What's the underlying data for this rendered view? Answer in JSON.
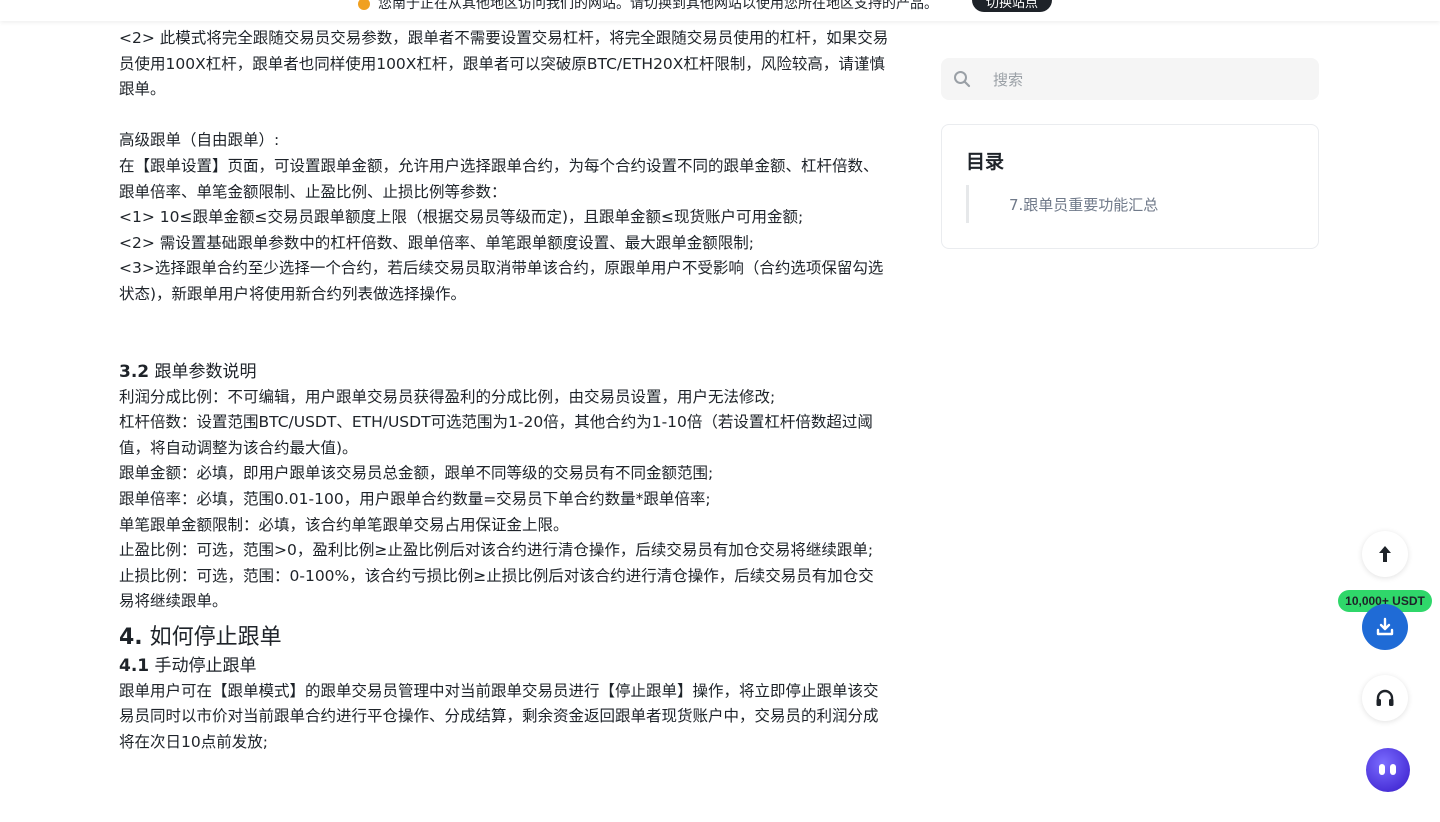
{
  "topbar": {
    "notice": "您南于正在从其他地区访问我们的网站。请切换到其他网站以使用您所在地区支持的产品。",
    "switch_label": "切换站点"
  },
  "article": {
    "p1": "<2> 此模式将完全跟随交易员交易参数，跟单者不需要设置交易杠杆，将完全跟随交易员使用的杠杆，如果交易员使用100X杠杆，跟单者也同样使用100X杠杆，跟单者可以突破原BTC/ETH20X杠杆限制，风险较高，请谨慎跟单。",
    "p2": "高级跟单（自由跟单）:",
    "p3": "在【跟单设置】页面，可设置跟单金额，允许用户选择跟单合约，为每个合约设置不同的跟单金额、杠杆倍数、跟单倍率、单笔金额限制、止盈比例、止损比例等参数：",
    "p4": "<1> 10≤跟单金额≤交易员跟单额度上限（根据交易员等级而定)，且跟单金额≤现货账户可用金额;",
    "p5": "<2> 需设置基础跟单参数中的杠杆倍数、跟单倍率、单笔跟单额度设置、最大跟单金额限制;",
    "p6": "<3>选择跟单合约至少选择一个合约，若后续交易员取消带单该合约，原跟单用户不受影响（合约选项保留勾选状态)，新跟单用户将使用新合约列表做选择操作。",
    "h32_num": "3.2",
    "h32_text": "跟单参数说明",
    "p7": "利润分成比例：不可编辑，用户跟单交易员获得盈利的分成比例，由交易员设置，用户无法修改;",
    "p8": "杠杆倍数：设置范围BTC/USDT、ETH/USDT可选范围为1-20倍，其他合约为1-10倍（若设置杠杆倍数超过阈值，将自动调整为该合约最大值)。",
    "p9": "跟单金额：必填，即用户跟单该交易员总金额，跟单不同等级的交易员有不同金额范围;",
    "p10": "跟单倍率：必填，范围0.01-100，用户跟单合约数量=交易员下单合约数量*跟单倍率;",
    "p11": "单笔跟单金额限制：必填，该合约单笔跟单交易占用保证金上限。",
    "p12": "止盈比例：可选，范围>0，盈利比例≥止盈比例后对该合约进行清仓操作，后续交易员有加仓交易将继续跟单;",
    "p13": "止损比例：可选，范围：0-100%，该合约亏损比例≥止损比例后对该合约进行清仓操作，后续交易员有加仓交易将继续跟单。",
    "h4_num": "4.",
    "h4_text": "如何停止跟单",
    "h41_num": "4.1",
    "h41_text": "手动停止跟单",
    "p14": "跟单用户可在【跟单模式】的跟单交易员管理中对当前跟单交易员进行【停止跟单】操作，将立即停止跟单该交易员同时以市价对当前跟单合约进行平仓操作、分成结算，剩余资金返回跟单者现货账户中，交易员的利润分成将在次日10点前发放;"
  },
  "search": {
    "placeholder": "搜索",
    "value": "",
    "icon": "search-icon"
  },
  "toc": {
    "title": "目录",
    "items": [
      "7.跟单员重要功能汇总"
    ]
  },
  "floating": {
    "badge": "10,000+ USDT",
    "icons": [
      "arrow-up-icon",
      "download-icon",
      "headset-icon",
      "chatbot-icon"
    ]
  },
  "colors": {
    "primary": "#1f6bd6",
    "badge": "#2fd76a",
    "text": "#1e2329",
    "muted": "#707a8a"
  }
}
